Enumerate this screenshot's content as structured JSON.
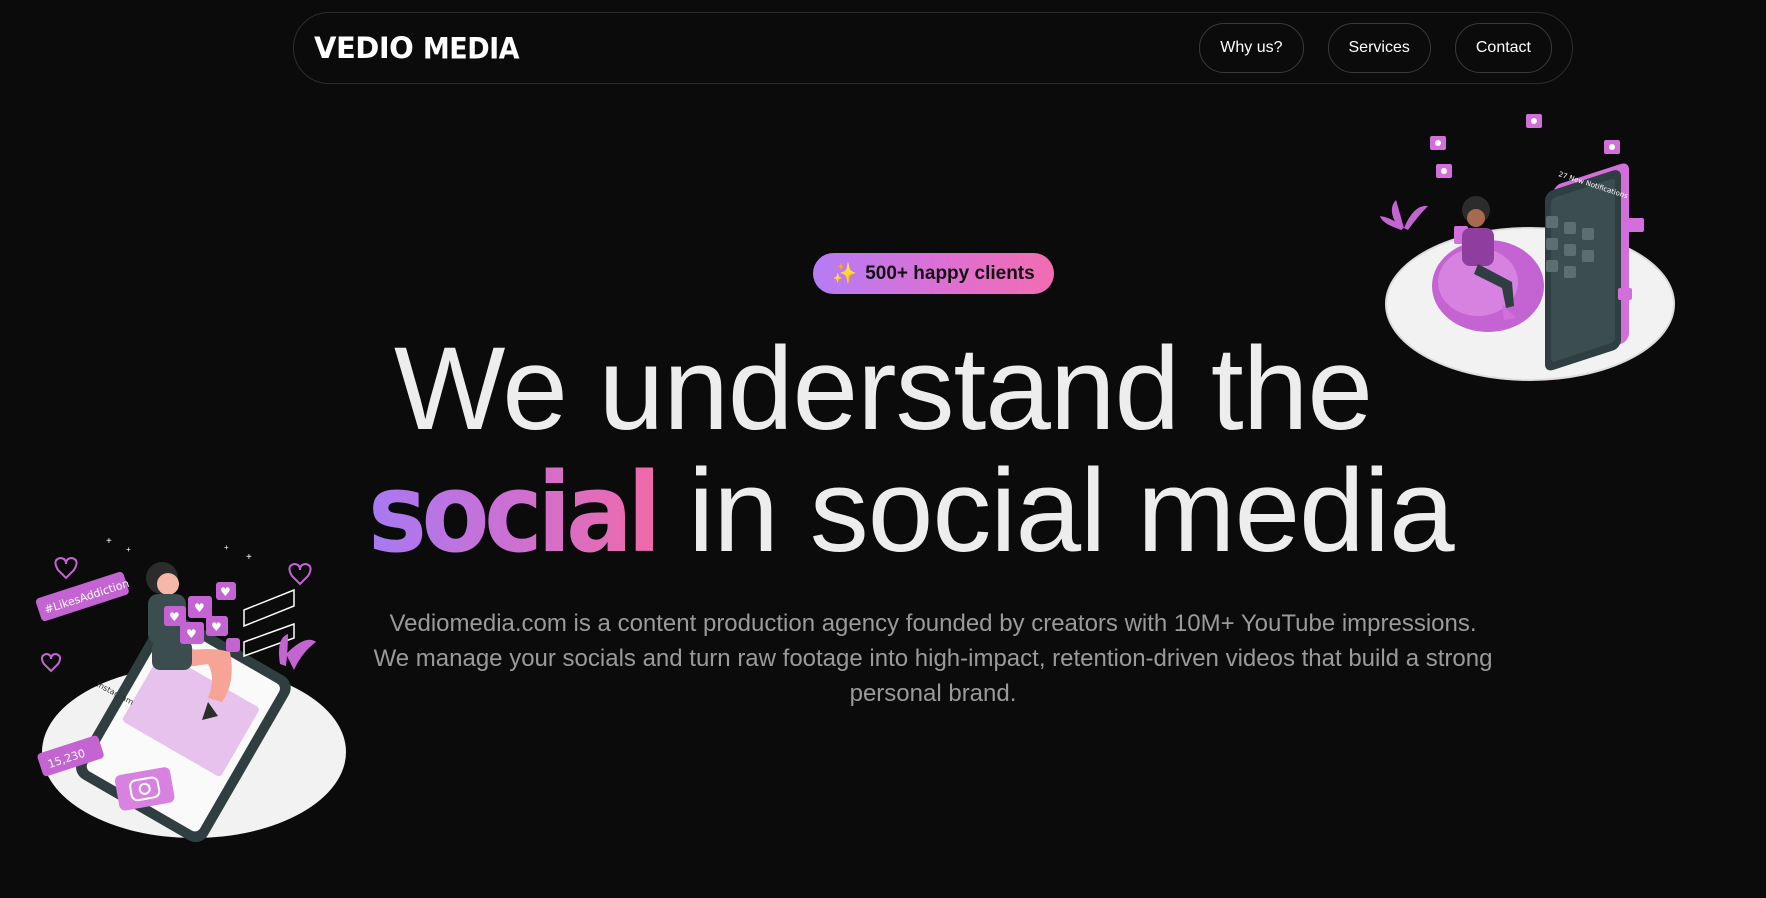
{
  "brand": {
    "logo_a": "VEDIO",
    "logo_b": "MEDIA"
  },
  "nav": {
    "items": [
      {
        "label": "Why us?"
      },
      {
        "label": "Services"
      },
      {
        "label": "Contact"
      }
    ]
  },
  "hero": {
    "badge_icon": "sparkles-icon",
    "badge_text": "500+ happy clients",
    "headline_line1": "We understand the",
    "headline_highlight": "social",
    "headline_line2_rest": " in social media",
    "subtitle": "Vediomedia.com is a content production agency founded by creators with 10M+ YouTube impressions. We manage your socials and turn raw footage into high-impact, retention-driven videos that build a strong personal brand."
  },
  "illustrations": {
    "left": {
      "tag": "#LikesAddiction",
      "count": "15,230",
      "app": "Instagram"
    },
    "right": {
      "screen_title": "27 New Notifications"
    }
  },
  "colors": {
    "background": "#0b0b0b",
    "accent_purple": "#b57cf5",
    "accent_pink": "#f26db1",
    "illustration_purple": "#c86ed8"
  }
}
